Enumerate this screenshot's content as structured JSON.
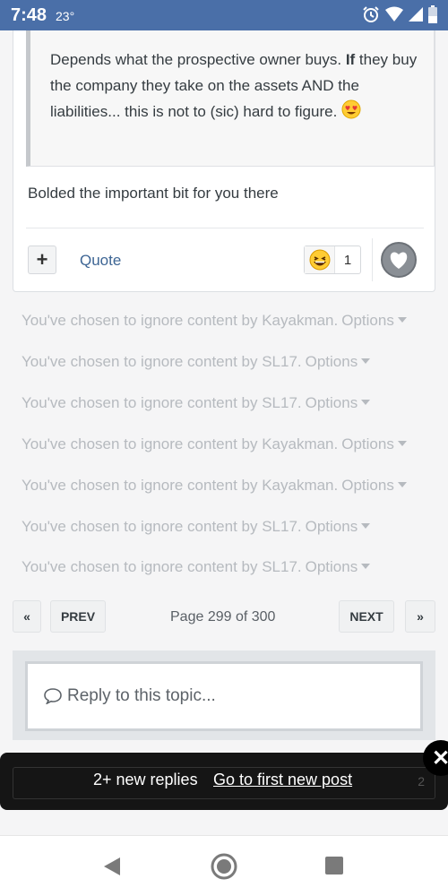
{
  "status_bar": {
    "time": "7:48",
    "temperature": "23°"
  },
  "post": {
    "quote_part1": "Depends what the prospective owner buys. ",
    "quote_bold": "If",
    "quote_part2": " they buy the company they take on the assets AND the liabilities... this is not to (sic) hard to figure.",
    "text": "Bolded the important bit for you there",
    "plus_label": "+",
    "quote_label": "Quote",
    "reaction_count": "1"
  },
  "ignored": [
    {
      "prefix": "You've chosen to ignore content by Kayakman.",
      "options": "Options"
    },
    {
      "prefix": "You've chosen to ignore content by SL17.",
      "options": "Options"
    },
    {
      "prefix": "You've chosen to ignore content by SL17.",
      "options": "Options"
    },
    {
      "prefix": "You've chosen to ignore content by Kayakman.",
      "options": "Options"
    },
    {
      "prefix": "You've chosen to ignore content by Kayakman.",
      "options": "Options"
    },
    {
      "prefix": "You've chosen to ignore content by SL17.",
      "options": "Options"
    },
    {
      "prefix": "You've chosen to ignore content by SL17.",
      "options": "Options"
    }
  ],
  "pagination": {
    "first": "«",
    "prev": "PREV",
    "page_text": "Page 299 of 300",
    "next": "NEXT",
    "last": "»"
  },
  "reply": {
    "placeholder": "Reply to this topic..."
  },
  "toast": {
    "message": "2+ new replies",
    "link": "Go to first new post",
    "ghost_count": "2",
    "close": "✕"
  }
}
